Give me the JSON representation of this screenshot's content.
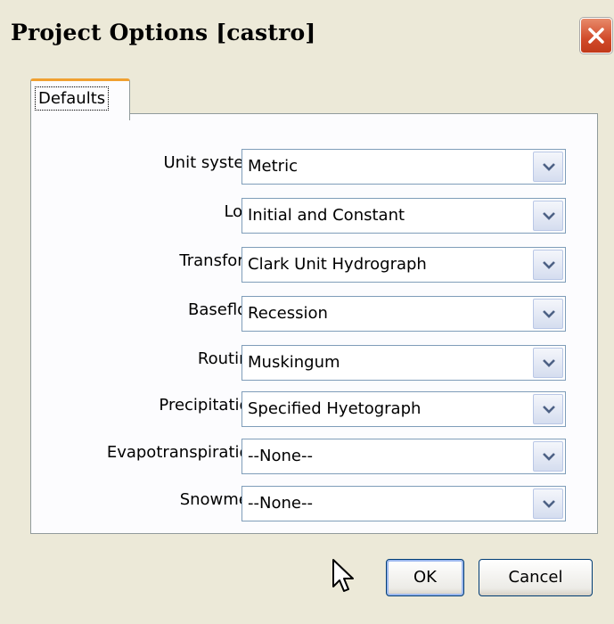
{
  "window": {
    "title": "Project Options [castro]"
  },
  "tabs": [
    {
      "label": "Defaults"
    }
  ],
  "fields": [
    {
      "label": "Unit system:",
      "value": "Metric"
    },
    {
      "label": "Loss:",
      "value": "Initial and Constant"
    },
    {
      "label": "Transform:",
      "value": "Clark Unit Hydrograph"
    },
    {
      "label": "Baseflow:",
      "value": "Recession"
    },
    {
      "label": "Routing:",
      "value": "Muskingum"
    },
    {
      "label": "Precipitation:",
      "value": "Specified Hyetograph"
    },
    {
      "label": "Evapotranspiration:",
      "value": "--None--"
    },
    {
      "label": "Snowmelt:",
      "value": "--None--"
    }
  ],
  "buttons": {
    "ok_label": "OK",
    "cancel_label": "Cancel"
  },
  "icons": {
    "close": "close-icon",
    "dropdown": "chevron-down-icon",
    "cursor": "mouse-pointer-icon"
  },
  "colors": {
    "dialog_bg": "#ece9d8",
    "panel_bg": "#fcfcfe",
    "close_button": "#d14a2a",
    "tab_highlight": "#f0a030",
    "input_border": "#7f9db9"
  }
}
